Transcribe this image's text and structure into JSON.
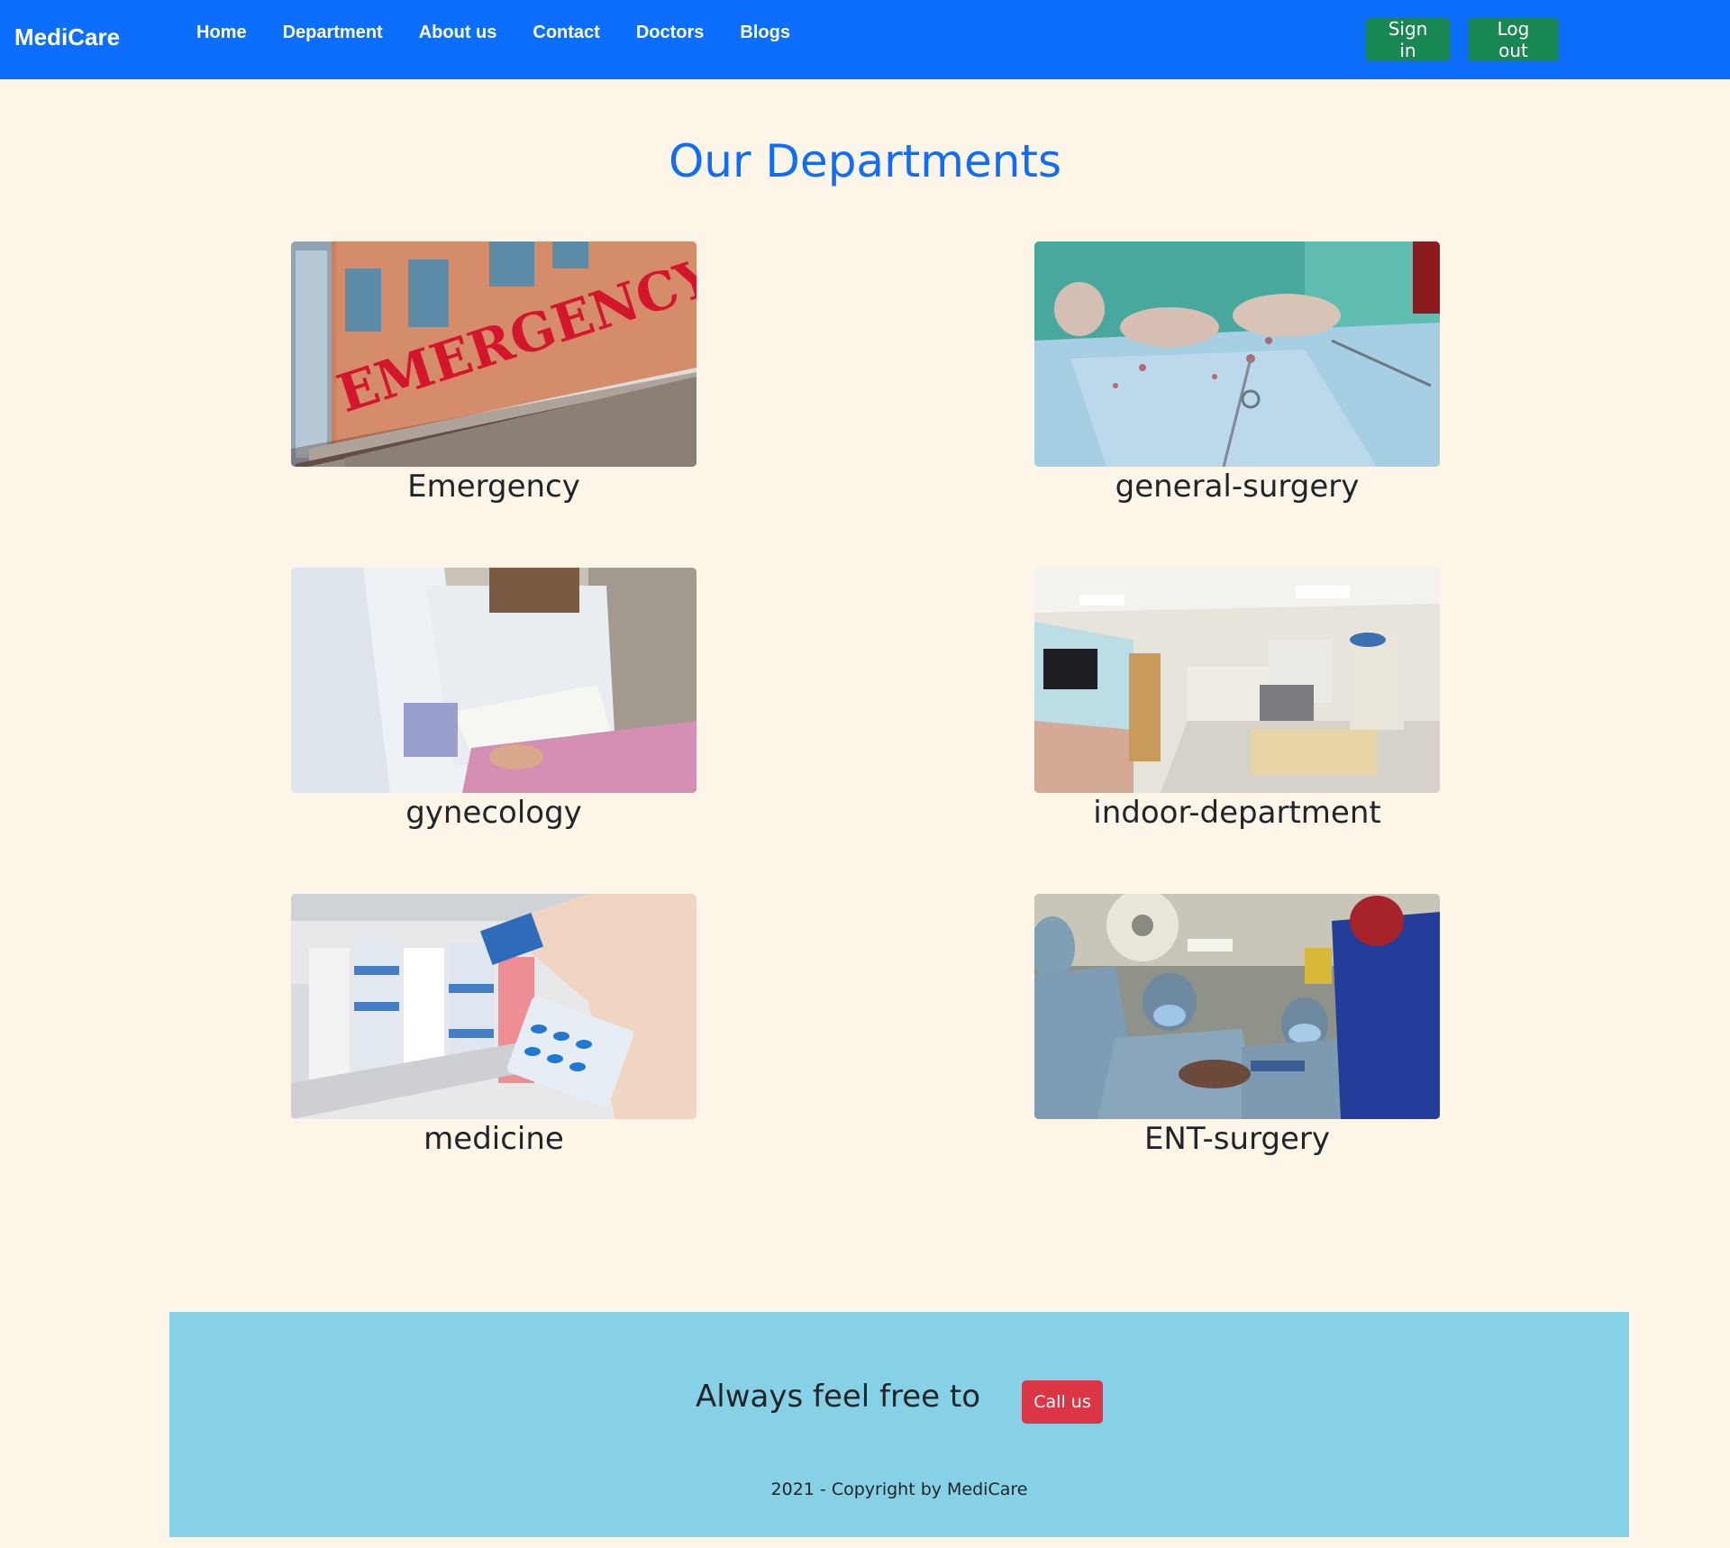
{
  "navbar": {
    "brand": "MediCare",
    "links": [
      "Home",
      "Department",
      "About us",
      "Contact",
      "Doctors",
      "Blogs"
    ],
    "sign_in_label": "Sign in",
    "log_out_label": "Log out",
    "background_color": "#0d6efd"
  },
  "main": {
    "title": "Our Departments",
    "departments": [
      {
        "name": "Emergency",
        "image": "emergency-photo"
      },
      {
        "name": "general-surgery",
        "image": "surgery-photo"
      },
      {
        "name": "gynecology",
        "image": "gynecology-photo"
      },
      {
        "name": "indoor-department",
        "image": "ward-photo"
      },
      {
        "name": "medicine",
        "image": "pharmacy-photo"
      },
      {
        "name": "ENT-surgery",
        "image": "operating-room-photo"
      }
    ]
  },
  "footer": {
    "tagline": "Always feel free to",
    "call_label": "Call us",
    "copyright": "2021 - Copyright by MediCare",
    "background_color": "#87d1e6"
  },
  "colors": {
    "page_background": "#fdf5e8",
    "title": "#0d6efd",
    "success_button": "#198754",
    "danger_button": "#dc3545"
  }
}
